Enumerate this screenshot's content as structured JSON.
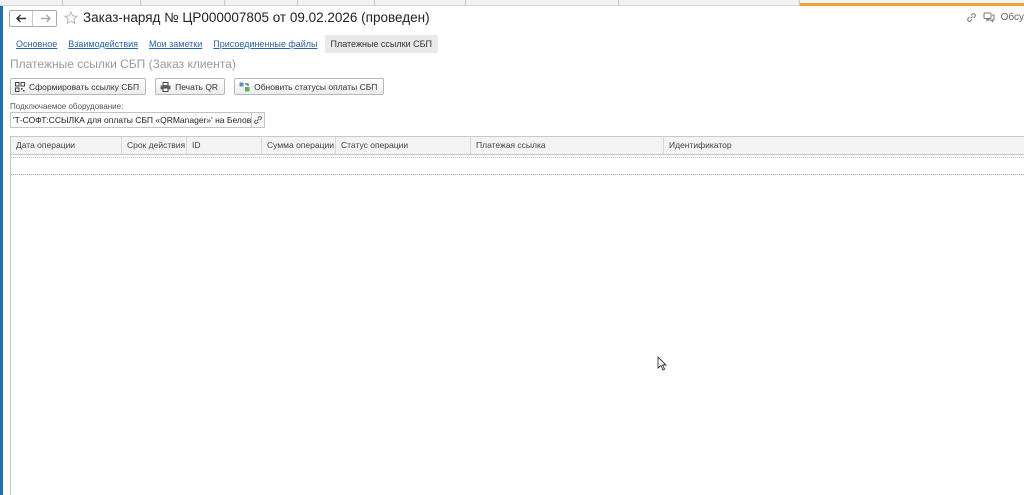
{
  "header": {
    "title": "Заказ-наряд № ЦР000007805 от 09.02.2026 (проведен)",
    "back_icon": "arrow-left-icon",
    "forward_icon": "arrow-right-icon",
    "favorite_icon": "star-icon",
    "right_label": "Обсу"
  },
  "tabs": [
    {
      "label": "Основное",
      "active": false
    },
    {
      "label": "Взаимодействия",
      "active": false
    },
    {
      "label": "Мои заметки",
      "active": false
    },
    {
      "label": "Присоединенные файлы",
      "active": false
    },
    {
      "label": "Платежные ссылки СБП",
      "active": true
    }
  ],
  "section": {
    "title": "Платежные ссылки СБП (Заказ клиента)"
  },
  "toolbar": {
    "generate_label": "Сформировать ссылку СБП",
    "print_label": "Печать QR",
    "refresh_label": "Обновить статусы оплаты СБП"
  },
  "equipment": {
    "label": "Подключаемое оборудование:",
    "value": "'Т-СОФТ:ССЫЛКА для оплаты СБП «QRManager»' на БеловаМБ"
  },
  "table": {
    "columns": [
      "Дата операции",
      "Срок действия",
      "ID",
      "Сумма операции",
      "Статус операции",
      "Платежая ссылка",
      "Идентификатор"
    ],
    "rows": []
  },
  "colors": {
    "accent": "#1d6fb8",
    "link": "#2a62a8",
    "active_tab_strip": "#f0a030"
  }
}
